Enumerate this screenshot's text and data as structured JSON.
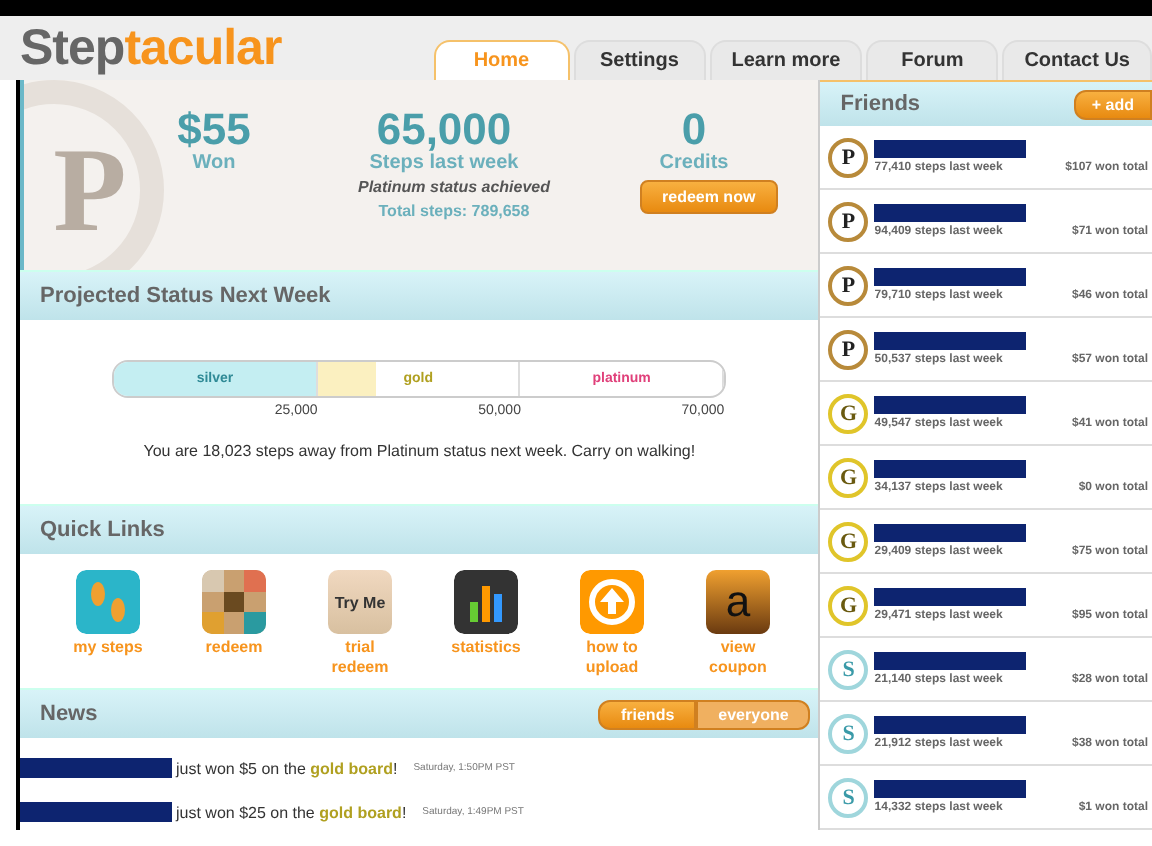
{
  "logo": {
    "first": "Step",
    "second": "tacular"
  },
  "tabs": [
    {
      "label": "Home",
      "selected": true
    },
    {
      "label": "Settings",
      "selected": false
    },
    {
      "label": "Learn more",
      "selected": false
    },
    {
      "label": "Forum",
      "selected": false
    },
    {
      "label": "Contact Us",
      "selected": false
    }
  ],
  "summary": {
    "emblem": "P",
    "stats": [
      {
        "value": "$55",
        "label": "Won"
      },
      {
        "value": "65,000",
        "label": "Steps last week"
      },
      {
        "value": "0",
        "label": "Credits"
      }
    ],
    "status_note": "Platinum status achieved",
    "total_steps": "Total steps: 789,658",
    "redeem_button": "redeem now"
  },
  "projected": {
    "title": "Projected Status Next Week",
    "level": 0.43,
    "segments": [
      {
        "label": "silver",
        "tick": "25,000"
      },
      {
        "label": "gold",
        "tick": "50,000"
      },
      {
        "label": "platinum",
        "tick": "70,000"
      }
    ],
    "message": "You are 18,023 steps away from Platinum status next week. Carry on walking!"
  },
  "quick_links": {
    "title": "Quick Links",
    "items": [
      {
        "kind": "steps",
        "label": "my steps"
      },
      {
        "kind": "redeem",
        "label": "redeem"
      },
      {
        "kind": "trial",
        "label": "trial redeem",
        "icon_text": "Try Me"
      },
      {
        "kind": "statistics",
        "label": "statistics"
      },
      {
        "kind": "upload",
        "label": "how to upload"
      },
      {
        "kind": "coupon",
        "label": "view coupon",
        "icon_text": "a"
      }
    ]
  },
  "news": {
    "title": "News",
    "filters": [
      {
        "label": "friends",
        "selected": true
      },
      {
        "label": "everyone",
        "selected": false
      }
    ],
    "items": [
      {
        "text": "just won $5 on the ",
        "board": "gold board",
        "end": "!",
        "time": "Saturday, 1:50PM PST"
      },
      {
        "text": "just won $25 on the ",
        "board": "gold board",
        "end": "!",
        "time": "Saturday, 1:49PM PST"
      }
    ]
  },
  "friends": {
    "title": "Friends",
    "add_button": "+ add",
    "rows": [
      {
        "kind": "platinum",
        "badge": "P",
        "steps": "77,410 steps last week",
        "won": "$107 won total"
      },
      {
        "kind": "platinum",
        "badge": "P",
        "steps": "94,409 steps last week",
        "won": "$71 won total"
      },
      {
        "kind": "platinum",
        "badge": "P",
        "steps": "79,710 steps last week",
        "won": "$46 won total"
      },
      {
        "kind": "platinum",
        "badge": "P",
        "steps": "50,537 steps last week",
        "won": "$57 won total"
      },
      {
        "kind": "gold",
        "badge": "G",
        "steps": "49,547 steps last week",
        "won": "$41 won total"
      },
      {
        "kind": "gold",
        "badge": "G",
        "steps": "34,137 steps last week",
        "won": "$0 won total"
      },
      {
        "kind": "gold",
        "badge": "G",
        "steps": "29,409 steps last week",
        "won": "$75 won total"
      },
      {
        "kind": "gold",
        "badge": "G",
        "steps": "29,471 steps last week",
        "won": "$95 won total"
      },
      {
        "kind": "silver",
        "badge": "S",
        "steps": "21,140 steps last week",
        "won": "$28 won total"
      },
      {
        "kind": "silver",
        "badge": "S",
        "steps": "21,912 steps last week",
        "won": "$38 won total"
      },
      {
        "kind": "silver",
        "badge": "S",
        "steps": "14,332 steps last week",
        "won": "$1 won total"
      }
    ]
  }
}
